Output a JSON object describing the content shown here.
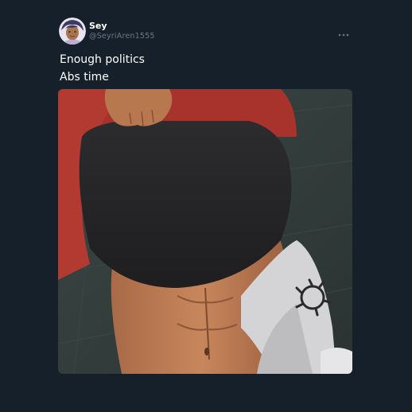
{
  "tweet": {
    "author": {
      "display_name": "Sey",
      "handle": "@SeyriAren1555",
      "avatar_icon": "avatar-illustration"
    },
    "more_icon": "more-horizontal-icon",
    "text_lines": [
      "Enough politics",
      "Abs time"
    ],
    "media_icon": "illustration-abs"
  },
  "colors": {
    "background": "#15202b",
    "text_primary": "#ffffff",
    "text_secondary": "#6b7785"
  }
}
